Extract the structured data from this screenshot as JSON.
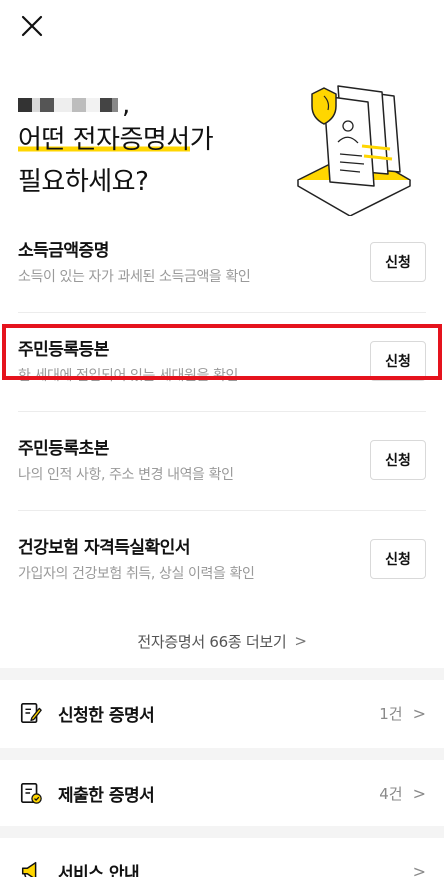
{
  "header": {
    "close_icon": "close-icon"
  },
  "greeting": {
    "name_suffix": ",",
    "line1_highlight": "어떤 전자증명서",
    "line1_rest": "가",
    "line2": "필요하세요?"
  },
  "documents": [
    {
      "title": "소득금액증명",
      "desc": "소득이 있는 자가 과세된 소득금액을 확인",
      "button": "신청"
    },
    {
      "title": "주민등록등본",
      "desc": "한 세대에 전입되어 있는 세대원을 확인",
      "button": "신청"
    },
    {
      "title": "주민등록초본",
      "desc": "나의 인적 사항, 주소 변경 내역을 확인",
      "button": "신청"
    },
    {
      "title": "건강보험 자격득실확인서",
      "desc": "가입자의 건강보험 취득, 상실 이력을 확인",
      "button": "신청"
    }
  ],
  "more": {
    "label": "전자증명서 66종 더보기",
    "chevron": ">"
  },
  "menu": [
    {
      "label": "신청한 증명서",
      "count": "1건",
      "icon": "edit-document-icon"
    },
    {
      "label": "제출한 증명서",
      "count": "4건",
      "icon": "submitted-document-icon"
    },
    {
      "label": "서비스 안내",
      "count": "",
      "icon": "megaphone-icon"
    }
  ],
  "colors": {
    "accent": "#ffd600",
    "highlight_frame": "#e5131d",
    "muted_text": "#9a9a9a"
  }
}
